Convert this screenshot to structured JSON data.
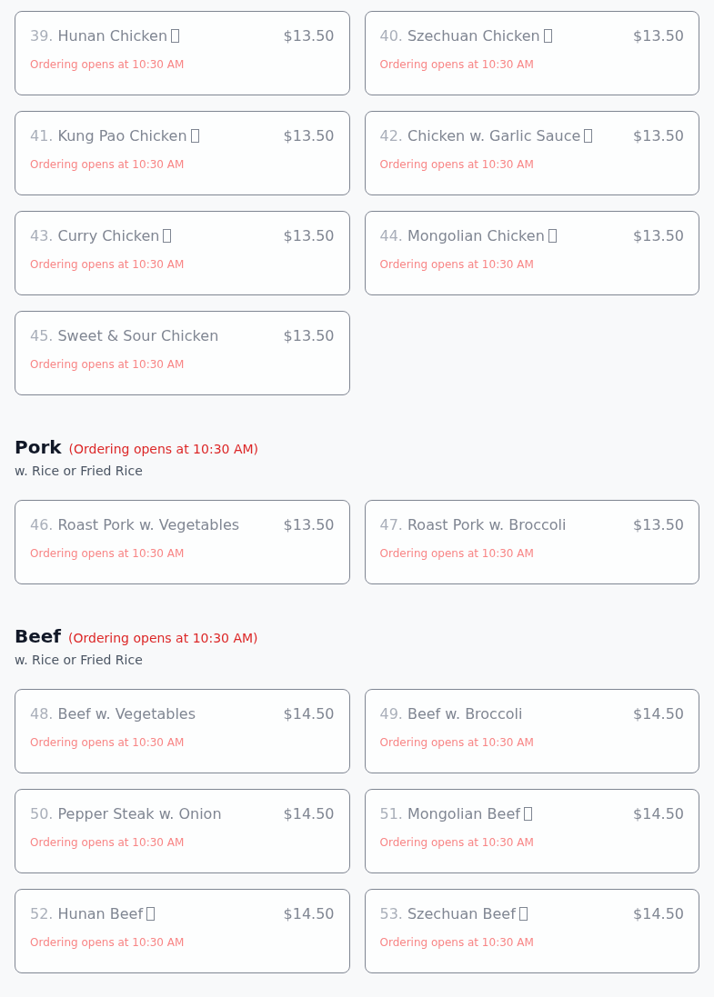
{
  "sections": [
    {
      "items": [
        {
          "number": "39.",
          "name": "Hunan Chicken",
          "spicy": true,
          "price": "$13.50",
          "note": "Ordering opens at 10:30 AM"
        },
        {
          "number": "40.",
          "name": "Szechuan Chicken",
          "spicy": true,
          "price": "$13.50",
          "note": "Ordering opens at 10:30 AM"
        },
        {
          "number": "41.",
          "name": "Kung Pao Chicken",
          "spicy": true,
          "price": "$13.50",
          "note": "Ordering opens at 10:30 AM"
        },
        {
          "number": "42.",
          "name": "Chicken w. Garlic Sauce",
          "spicy": true,
          "price": "$13.50",
          "note": "Ordering opens at 10:30 AM"
        },
        {
          "number": "43.",
          "name": "Curry Chicken",
          "spicy": true,
          "price": "$13.50",
          "note": "Ordering opens at 10:30 AM"
        },
        {
          "number": "44.",
          "name": "Mongolian Chicken",
          "spicy": true,
          "price": "$13.50",
          "note": "Ordering opens at 10:30 AM"
        },
        {
          "number": "45.",
          "name": "Sweet & Sour Chicken",
          "spicy": false,
          "price": "$13.50",
          "note": "Ordering opens at 10:30 AM"
        }
      ]
    },
    {
      "title": "Pork",
      "status": "(Ordering opens at 10:30 AM)",
      "subtitle": "w. Rice or Fried Rice",
      "items": [
        {
          "number": "46.",
          "name": "Roast Pork w. Vegetables",
          "spicy": false,
          "price": "$13.50",
          "note": "Ordering opens at 10:30 AM"
        },
        {
          "number": "47.",
          "name": "Roast Pork w. Broccoli",
          "spicy": false,
          "price": "$13.50",
          "note": "Ordering opens at 10:30 AM"
        }
      ]
    },
    {
      "title": "Beef",
      "status": "(Ordering opens at 10:30 AM)",
      "subtitle": "w. Rice or Fried Rice",
      "items": [
        {
          "number": "48.",
          "name": "Beef w. Vegetables",
          "spicy": false,
          "price": "$14.50",
          "note": "Ordering opens at 10:30 AM"
        },
        {
          "number": "49.",
          "name": "Beef w. Broccoli",
          "spicy": false,
          "price": "$14.50",
          "note": "Ordering opens at 10:30 AM"
        },
        {
          "number": "50.",
          "name": "Pepper Steak w. Onion",
          "spicy": false,
          "price": "$14.50",
          "note": "Ordering opens at 10:30 AM"
        },
        {
          "number": "51.",
          "name": "Mongolian Beef",
          "spicy": true,
          "price": "$14.50",
          "note": "Ordering opens at 10:30 AM"
        },
        {
          "number": "52.",
          "name": "Hunan Beef",
          "spicy": true,
          "price": "$14.50",
          "note": "Ordering opens at 10:30 AM"
        },
        {
          "number": "53.",
          "name": "Szechuan Beef",
          "spicy": true,
          "price": "$14.50",
          "note": "Ordering opens at 10:30 AM"
        }
      ]
    }
  ]
}
